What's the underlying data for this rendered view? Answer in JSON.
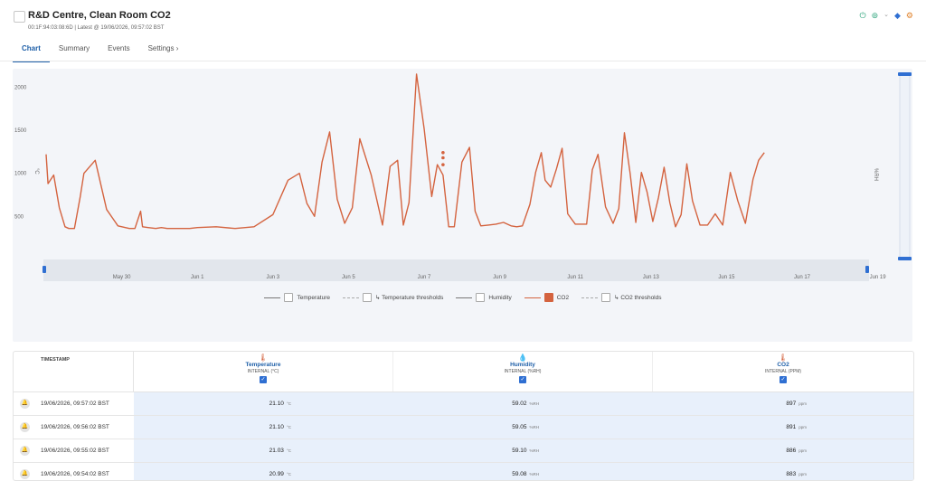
{
  "header": {
    "title": "R&D Centre, Clean Room CO2",
    "subtitle": "00:1F:94:03:08:6D | Latest @ 19/06/2026, 09:57:02 BST",
    "icons": [
      "power-icon",
      "link-icon",
      "chevron-down-icon",
      "pin-icon",
      "settings-icon"
    ]
  },
  "tabs": [
    {
      "label": "Chart",
      "active": true
    },
    {
      "label": "Summary",
      "active": false
    },
    {
      "label": "Events",
      "active": false
    },
    {
      "label": "Settings ›",
      "active": false
    }
  ],
  "chart_data": {
    "type": "line",
    "x_ticks": [
      "May 30",
      "Jun 1",
      "Jun 3",
      "Jun 5",
      "Jun 7",
      "Jun 9",
      "Jun 11",
      "Jun 13",
      "Jun 15",
      "Jun 17",
      "Jun 19"
    ],
    "y_ticks": [
      500,
      1000,
      1500,
      2000
    ],
    "ylim": [
      0,
      2150
    ],
    "left_axis_label": "°C",
    "right_axis_label": "%RH",
    "series": [
      {
        "name": "CO2",
        "color": "#d4633f",
        "x_days": [
          0,
          0.05,
          0.2,
          0.35,
          0.5,
          0.6,
          0.75,
          0.9,
          1.0,
          1.3,
          1.6,
          1.9,
          2.2,
          2.35,
          2.5,
          2.55,
          2.7,
          2.9,
          3.05,
          3.2,
          3.4,
          3.6,
          3.8,
          4.0,
          4.5,
          5.0,
          5.5,
          6.0,
          6.4,
          6.7,
          6.9,
          7.1,
          7.3,
          7.5,
          7.7,
          7.9,
          8.1,
          8.3,
          8.6,
          8.9,
          9.1,
          9.3,
          9.45,
          9.6,
          9.8,
          10.0,
          10.2,
          10.35,
          10.5,
          10.65,
          10.8,
          11.0,
          11.2,
          11.35,
          11.5,
          11.7,
          11.9,
          12.1,
          12.3,
          12.45,
          12.6,
          12.8,
          12.95,
          13.1,
          13.2,
          13.35,
          13.5,
          13.65,
          13.8,
          14.0,
          14.3,
          14.45,
          14.6,
          14.8,
          15.0,
          15.15,
          15.3,
          15.45,
          15.6,
          15.75,
          15.9,
          16.05,
          16.2,
          16.35,
          16.5,
          16.65,
          16.8,
          16.95,
          17.1,
          17.3,
          17.5,
          17.7,
          17.9,
          18.1,
          18.3,
          18.5,
          18.7,
          18.85,
          19.0
        ],
        "values": [
          1220,
          880,
          980,
          600,
          380,
          360,
          360,
          720,
          1000,
          1150,
          580,
          390,
          360,
          360,
          560,
          380,
          370,
          360,
          370,
          360,
          360,
          360,
          360,
          370,
          380,
          360,
          380,
          520,
          920,
          1000,
          650,
          500,
          1130,
          1480,
          700,
          420,
          600,
          1400,
          980,
          400,
          1080,
          1150,
          400,
          660,
          2150,
          1520,
          730,
          1100,
          980,
          380,
          380,
          1130,
          1300,
          560,
          390,
          400,
          410,
          430,
          390,
          380,
          390,
          640,
          1010,
          1240,
          920,
          840,
          1050,
          1290,
          530,
          410,
          410,
          1040,
          1220,
          610,
          420,
          590,
          1470,
          1000,
          430,
          1010,
          780,
          440,
          720,
          1070,
          660,
          380,
          520,
          1110,
          680,
          400,
          400,
          530,
          400,
          1010,
          680,
          420,
          930,
          1150,
          1240,
          1230,
          650,
          1300,
          1100,
          700,
          450,
          1220,
          1280,
          1000,
          870
        ]
      }
    ],
    "markers": [
      {
        "x_day": 10.5,
        "values": [
          1240,
          1180,
          1100
        ]
      }
    ]
  },
  "legend": [
    {
      "label": "Temperature",
      "checked": false,
      "style": "solid"
    },
    {
      "label": "↳ Temperature thresholds",
      "checked": false,
      "style": "dashed"
    },
    {
      "label": "Humidity",
      "checked": false,
      "style": "solid"
    },
    {
      "label": "CO2",
      "checked": true,
      "style": "solid"
    },
    {
      "label": "↳ CO2 thresholds",
      "checked": false,
      "style": "dashed"
    }
  ],
  "table": {
    "timestamp_header": "TIMESTAMP",
    "columns": [
      {
        "name": "Temperature",
        "unit_label": "INTERNAL (°C)",
        "icon": "thermometer-icon",
        "icon_color": "#d4633f"
      },
      {
        "name": "Humidity",
        "unit_label": "INTERNAL (%RH)",
        "icon": "droplet-icon",
        "icon_color": "#2aa37a"
      },
      {
        "name": "CO2",
        "unit_label": "INTERNAL (PPM)",
        "icon": "thermometer-icon",
        "icon_color": "#d4633f"
      }
    ],
    "units": [
      "°C",
      "%RH",
      "ppm"
    ],
    "rows": [
      {
        "timestamp": "19/06/2026, 09:57:02 BST",
        "temperature": "21.10",
        "humidity": "59.02",
        "co2": "897"
      },
      {
        "timestamp": "19/06/2026, 09:56:02 BST",
        "temperature": "21.10",
        "humidity": "59.05",
        "co2": "891"
      },
      {
        "timestamp": "19/06/2026, 09:55:02 BST",
        "temperature": "21.03",
        "humidity": "59.10",
        "co2": "886"
      },
      {
        "timestamp": "19/06/2026, 09:54:02 BST",
        "temperature": "20.99",
        "humidity": "59.08",
        "co2": "883"
      }
    ]
  }
}
